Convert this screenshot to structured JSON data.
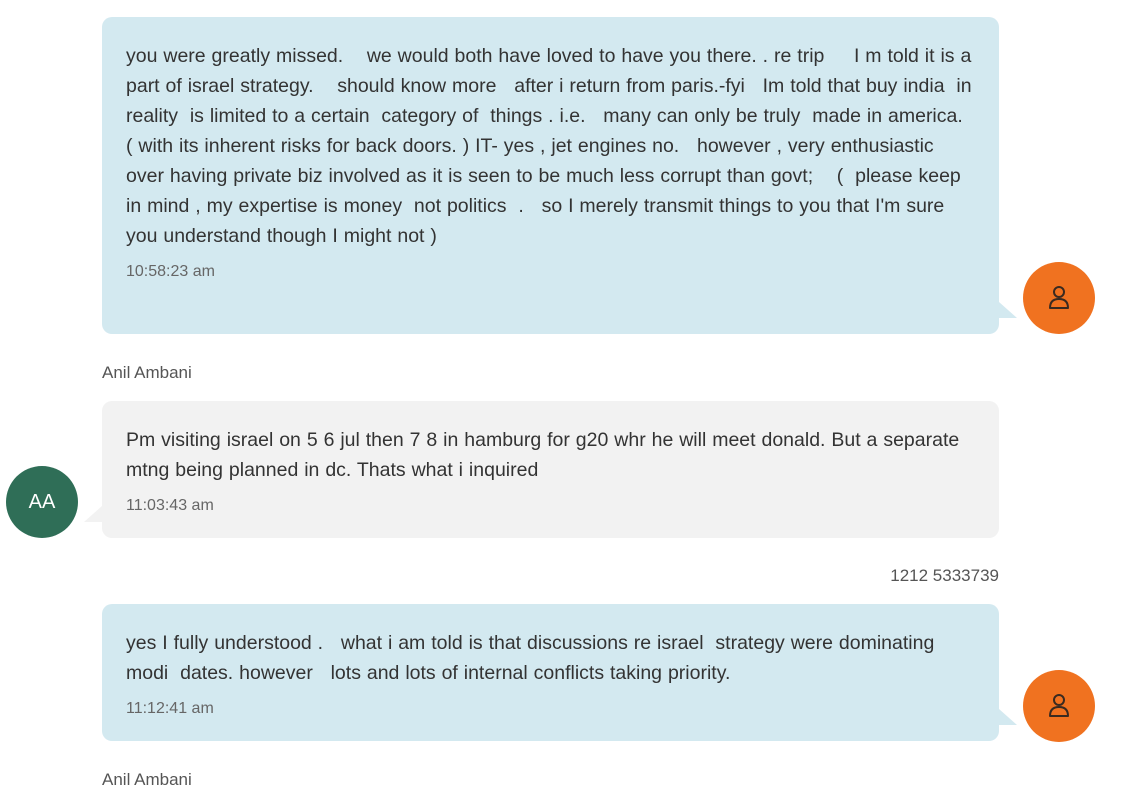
{
  "messages": [
    {
      "direction": "outgoing",
      "text": "you were greatly missed.    we would both have loved to have you there. . re trip     I m told it is a part of israel strategy.    should know more   after i return from paris.-fyi   Im told that buy india  in reality  is limited to a certain  category of  things . i.e.   many can only be truly  made in america.  ( with its inherent risks for back doors. ) IT- yes , jet engines no.   however , very enthusiastic over having private biz involved as it is seen to be much less corrupt than govt;    (  please keep in mind , my expertise is money  not politics  .   so I merely transmit things to you that I'm sure you understand though I might not )",
      "time": "10:58:23 am"
    },
    {
      "direction": "incoming",
      "sender": "Anil Ambani",
      "initials": "AA",
      "text": "Pm visiting israel on 5 6 jul then 7 8 in hamburg for g20 whr he will meet donald. But a separate mtng being planned in dc. Thats what i inquired",
      "time": "11:03:43 am"
    },
    {
      "direction": "outgoing",
      "sender": "1212 5333739",
      "text": "yes I fully understood .   what i am told is that discussions re israel  strategy were dominating modi  dates. however   lots and lots of internal conflicts taking priority.",
      "time": "11:12:41 am"
    }
  ],
  "footer_sender": "Anil Ambani",
  "colors": {
    "outgoing_bubble": "#d3e9f0",
    "incoming_bubble": "#f2f2f2",
    "me_avatar": "#f07220",
    "contact_avatar": "#2f6e57"
  },
  "icons": {
    "me_avatar": "user-outline-icon"
  }
}
